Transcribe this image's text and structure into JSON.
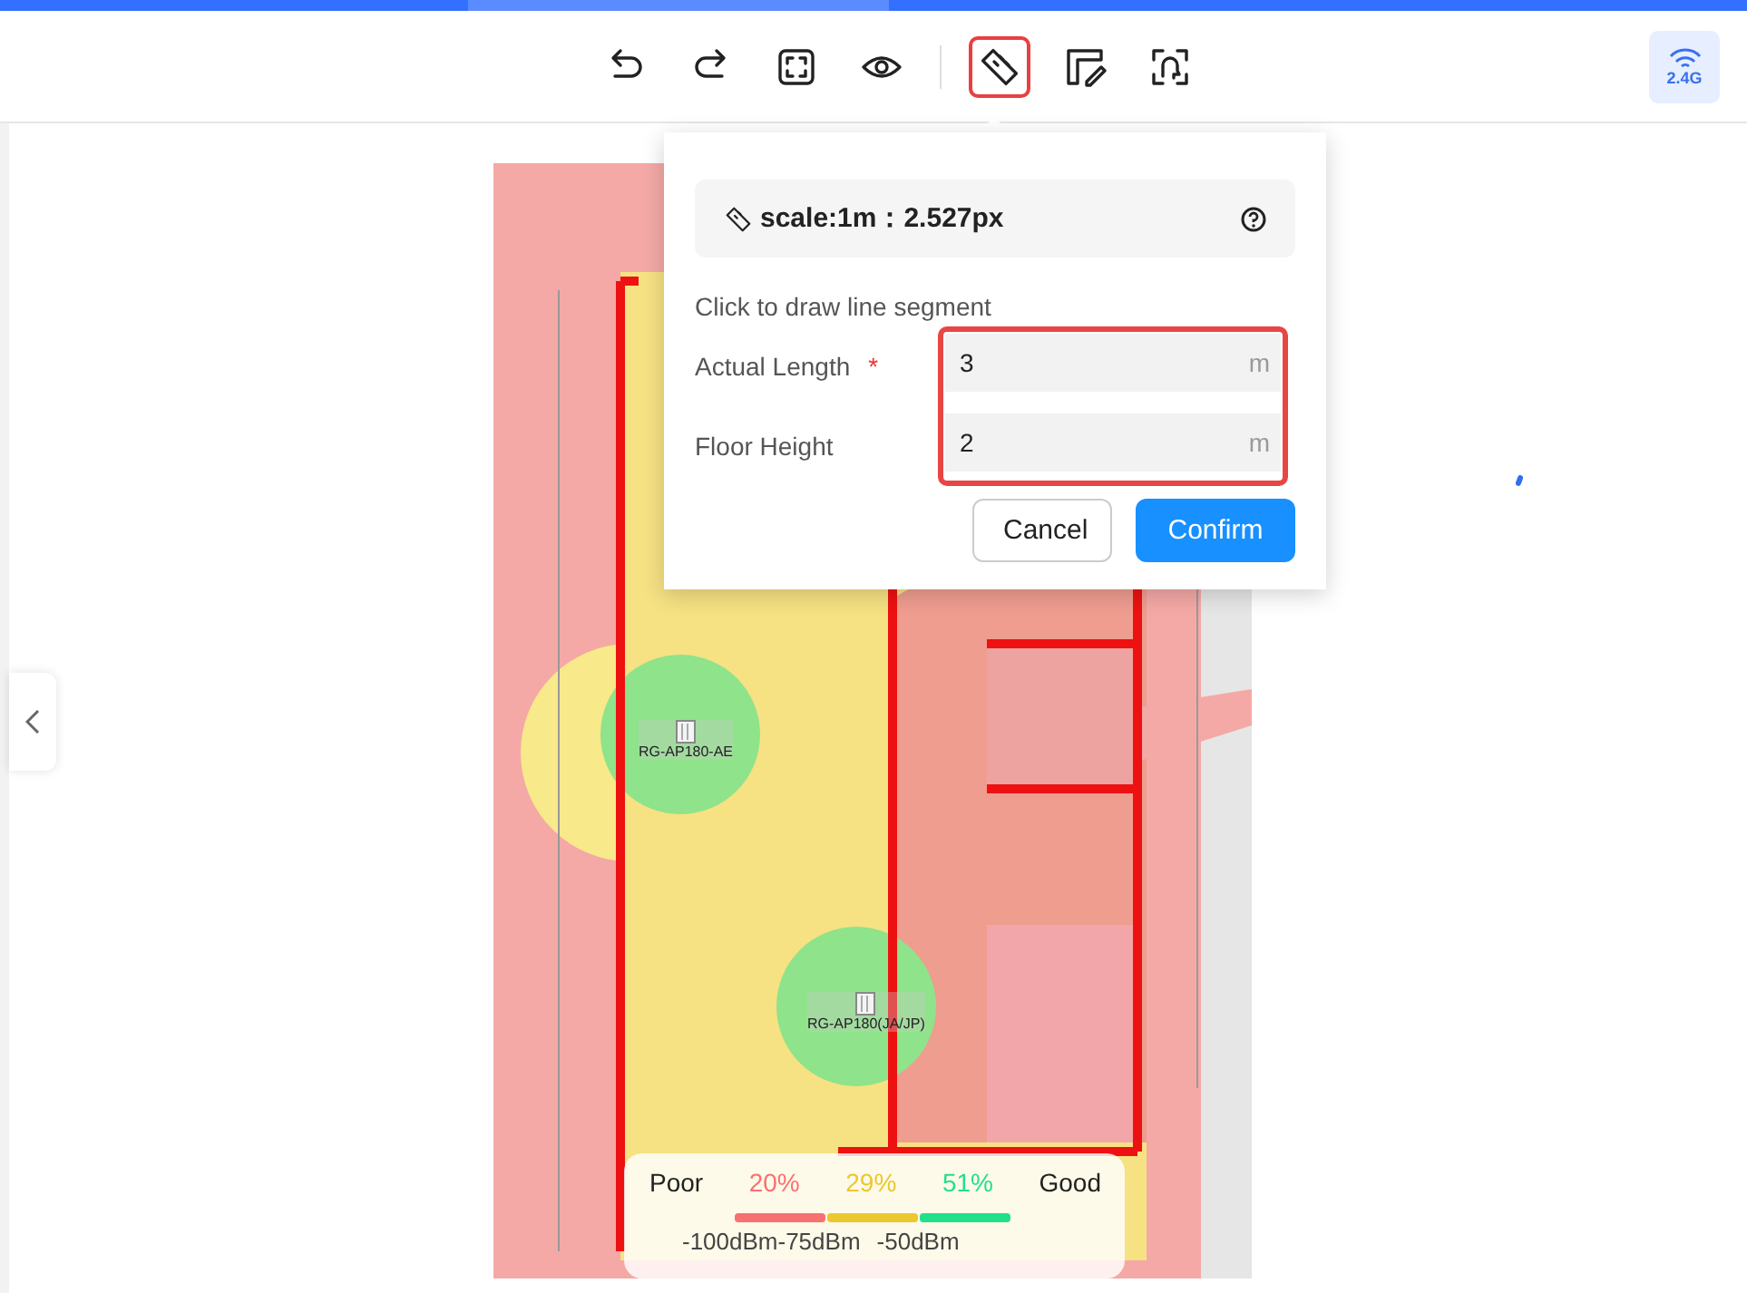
{
  "toolbar": {
    "tools": [
      {
        "kind": "undo",
        "selected": false
      },
      {
        "kind": "redo",
        "selected": false
      },
      {
        "kind": "fit",
        "selected": false
      },
      {
        "kind": "view",
        "selected": false
      },
      {
        "kind": "scale",
        "selected": true
      },
      {
        "kind": "draw",
        "selected": false
      },
      {
        "kind": "locate",
        "selected": false
      }
    ],
    "band": "2.4G"
  },
  "scale_popup": {
    "scale": "scale:1m：2.527px",
    "required_mark": "*",
    "instruction": "Click to draw line segment",
    "fields": [
      {
        "label": "Actual Length",
        "required": true,
        "value": "3",
        "unit": "m"
      },
      {
        "label": "Floor Height",
        "required": false,
        "value": "2",
        "unit": "m"
      }
    ],
    "buttons": [
      {
        "label": "Cancel",
        "kind": "secondary"
      },
      {
        "label": "Confirm",
        "kind": "primary"
      }
    ]
  },
  "floor_plan": {
    "kind": "picture",
    "access_points": [
      {
        "label": "RG-AP180-AE"
      },
      {
        "label": "RG-AP180(JA/JP)"
      }
    ]
  },
  "legend": {
    "poor": "Poor",
    "good": "Good",
    "levels": [
      {
        "share": "20%",
        "color": "#f87171"
      },
      {
        "share": "29%",
        "color": "#eac82e"
      },
      {
        "share": "51%",
        "color": "#22df8a"
      }
    ],
    "ticks": [
      "-100dBm",
      "-75dBm",
      "-50dBm"
    ]
  }
}
